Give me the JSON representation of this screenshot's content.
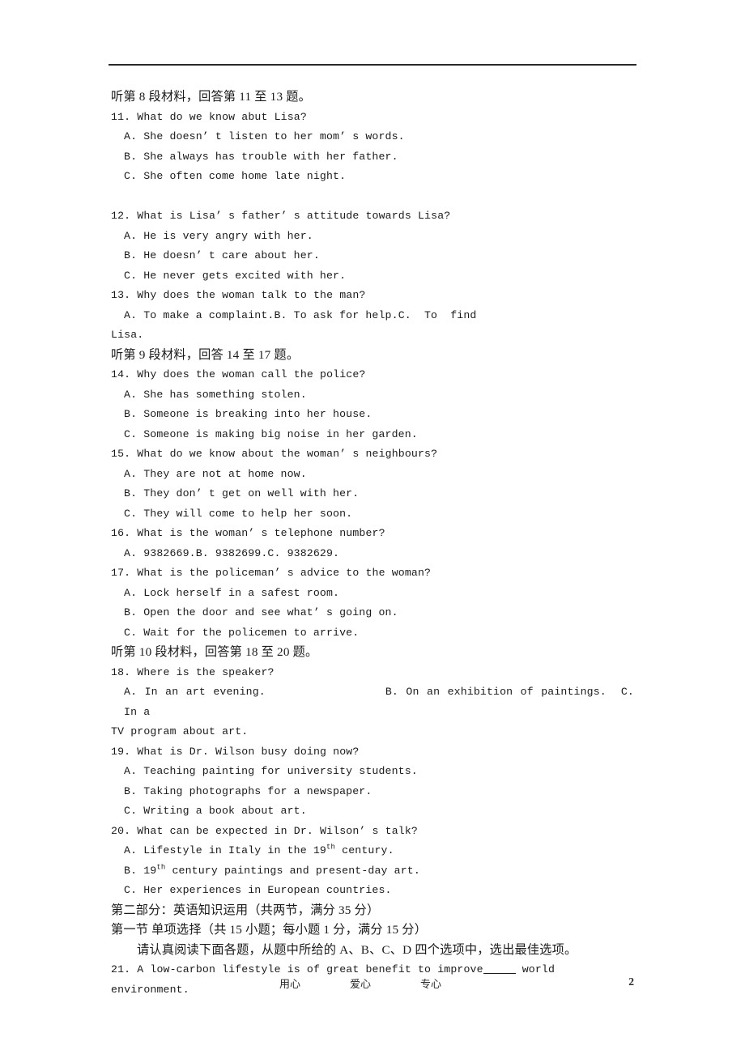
{
  "page": {
    "paper_type": "english-exam-answer-sheet-scan",
    "page_number": "2"
  },
  "sections": [
    {
      "heading": "听第 8 段材料，回答第 11 至 13 题。",
      "questions": [
        {
          "number": "11.",
          "stem": "11. What do we know abut Lisa?",
          "options": [
            "A. She doesn’ t listen to her mom’ s words.",
            "B. She always has trouble with her father.",
            "C. She often come home late night."
          ]
        },
        {
          "number": "12.",
          "stem": "12. What is Lisa’ s father’ s attitude towards Lisa?",
          "options": [
            "A. He is very angry with her.",
            "B. He doesn’ t care about her.",
            "C. He never gets excited with her."
          ]
        },
        {
          "number": "13.",
          "stem": "13. Why does the woman talk to the man?",
          "options_inline": {
            "a": "A. To make a complaint.",
            "b": "B. To ask for help.",
            "c": "C.  To  find",
            "c_tail": "Lisa."
          }
        }
      ]
    },
    {
      "heading": "听第 9 段材料，回答 14 至 17 题。",
      "questions": [
        {
          "number": "14.",
          "stem": "14. Why does the woman call the police?",
          "options": [
            "A. She has something stolen.",
            "B. Someone is breaking into her house.",
            "C. Someone is making big noise in her garden."
          ]
        },
        {
          "number": "15.",
          "stem": "15. What do we know about the woman’ s neighbours?",
          "options": [
            "A. They are not at home now.",
            "B. They don’ t get on well with her.",
            "C. They will come to help her soon."
          ]
        },
        {
          "number": "16.",
          "stem": "16. What is the woman’ s telephone number?",
          "options_spread": [
            "A. 9382669.",
            "B. 9382699.",
            "C. 9382629."
          ]
        },
        {
          "number": "17.",
          "stem": "17. What is the policeman’ s advice to the woman?",
          "options": [
            "A. Lock herself in a safest room.",
            "B. Open the door and see what’ s going on.",
            "C. Wait for the policemen to arrive."
          ]
        }
      ]
    },
    {
      "heading": "听第 10 段材料，回答第 18 至 20 题。",
      "questions": [
        {
          "number": "18.",
          "stem": "18. Where is the speaker?",
          "options_inline": {
            "a": "A. In an art evening.",
            "b": "B. On an exhibition of paintings.",
            "c": "C. In a",
            "c_tail": "TV program about art."
          }
        },
        {
          "number": "19.",
          "stem": "19. What is Dr. Wilson busy doing now?",
          "options": [
            "A. Teaching painting for university students.",
            "B. Taking photographs for a newspaper.",
            "C. Writing a book about art."
          ]
        },
        {
          "number": "20.",
          "stem": "20. What can be expected in Dr. Wilson’ s talk?",
          "options_sup": [
            {
              "pre": "A. Lifestyle in Italy in the 19",
              "sup": "th",
              "post": " century."
            },
            {
              "pre": "B. 19",
              "sup": "th",
              "post": " century paintings and present-day art."
            },
            {
              "pre": "C. Her experiences in European countries.",
              "sup": "",
              "post": ""
            }
          ]
        }
      ]
    }
  ],
  "part_two": {
    "part_heading": "第二部分：英语知识运用（共两节，满分 35 分）",
    "section_heading": "第一节 单项选择（共 15 小题；每小题 1 分，满分 15 分）",
    "instruction": "请认真阅读下面各题，从题中所给的 A、B、C、D 四个选项中，选出最佳选项。",
    "question_21": {
      "pre": "21. A low-carbon lifestyle is of great benefit to improve",
      "post": " world environment."
    }
  },
  "footer": {
    "word1": "用心",
    "word2": "爱心",
    "word3": "专心",
    "page_number": "2"
  }
}
